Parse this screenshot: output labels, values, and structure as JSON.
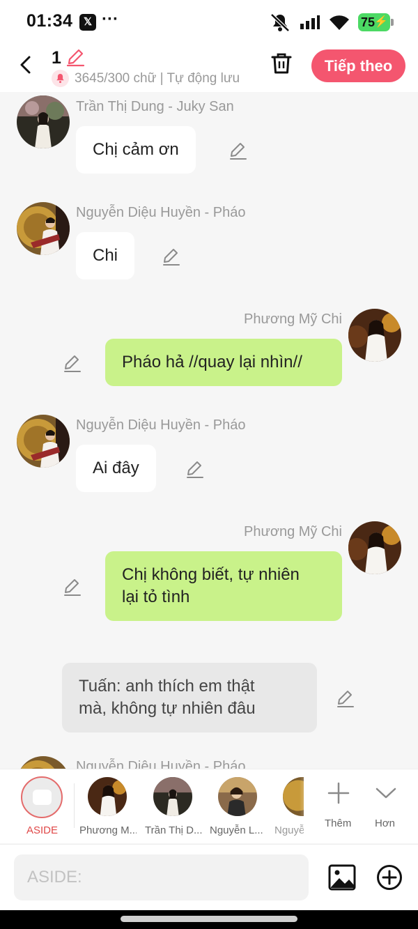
{
  "status_bar": {
    "time": "01:34",
    "x_badge": "𝕏",
    "more": "···",
    "battery": "75"
  },
  "header": {
    "title": "1",
    "word_count": "3645/300 chữ | Tự động lưu",
    "next_label": "Tiếp theo",
    "accent": "#f4566f"
  },
  "messages": [
    {
      "side": "left",
      "speaker": "Trần Thị Dung - Juky San",
      "text": "Chị cảm ơn"
    },
    {
      "side": "left",
      "speaker": "Nguyễn Diệu Huyền - Pháo",
      "text": "Chi"
    },
    {
      "side": "right",
      "speaker": "Phương Mỹ Chi",
      "text": "Pháo hả //quay lại nhìn//"
    },
    {
      "side": "left",
      "speaker": "Nguyễn Diệu Huyền - Pháo",
      "text": "Ai đây"
    },
    {
      "side": "right",
      "speaker": "Phương Mỹ Chi",
      "text_lines": [
        "Chị không biết, tự nhiên",
        "lại tỏ tình"
      ]
    },
    {
      "side": "aside",
      "text_lines": [
        "Tuấn: anh thích em thật",
        "mà, không tự nhiên đâu"
      ]
    },
    {
      "side": "left",
      "speaker": "Nguyễn Diệu Huyền - Pháo"
    }
  ],
  "character_bar": {
    "aside_label": "ASIDE",
    "characters": [
      {
        "label": "Phương M..."
      },
      {
        "label": "Trần Thị D..."
      },
      {
        "label": "Nguyễn L..."
      },
      {
        "label": "Nguyễ"
      }
    ],
    "add_label": "Thêm",
    "more_label": "Hơn"
  },
  "input": {
    "placeholder": "ASIDE:",
    "value": ""
  },
  "colors": {
    "green_bubble": "#c9f28a",
    "white_bubble": "#ffffff",
    "aside_bubble": "#e8e8e8",
    "background": "#f6f6f6"
  }
}
